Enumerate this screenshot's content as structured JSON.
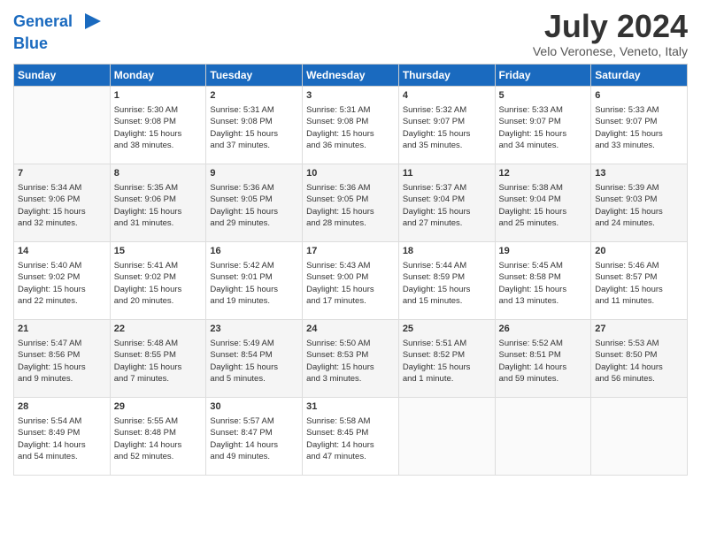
{
  "header": {
    "logo_line1": "General",
    "logo_line2": "Blue",
    "month_year": "July 2024",
    "location": "Velo Veronese, Veneto, Italy"
  },
  "weekdays": [
    "Sunday",
    "Monday",
    "Tuesday",
    "Wednesday",
    "Thursday",
    "Friday",
    "Saturday"
  ],
  "weeks": [
    [
      {
        "day": "",
        "lines": []
      },
      {
        "day": "1",
        "lines": [
          "Sunrise: 5:30 AM",
          "Sunset: 9:08 PM",
          "Daylight: 15 hours",
          "and 38 minutes."
        ]
      },
      {
        "day": "2",
        "lines": [
          "Sunrise: 5:31 AM",
          "Sunset: 9:08 PM",
          "Daylight: 15 hours",
          "and 37 minutes."
        ]
      },
      {
        "day": "3",
        "lines": [
          "Sunrise: 5:31 AM",
          "Sunset: 9:08 PM",
          "Daylight: 15 hours",
          "and 36 minutes."
        ]
      },
      {
        "day": "4",
        "lines": [
          "Sunrise: 5:32 AM",
          "Sunset: 9:07 PM",
          "Daylight: 15 hours",
          "and 35 minutes."
        ]
      },
      {
        "day": "5",
        "lines": [
          "Sunrise: 5:33 AM",
          "Sunset: 9:07 PM",
          "Daylight: 15 hours",
          "and 34 minutes."
        ]
      },
      {
        "day": "6",
        "lines": [
          "Sunrise: 5:33 AM",
          "Sunset: 9:07 PM",
          "Daylight: 15 hours",
          "and 33 minutes."
        ]
      }
    ],
    [
      {
        "day": "7",
        "lines": [
          "Sunrise: 5:34 AM",
          "Sunset: 9:06 PM",
          "Daylight: 15 hours",
          "and 32 minutes."
        ]
      },
      {
        "day": "8",
        "lines": [
          "Sunrise: 5:35 AM",
          "Sunset: 9:06 PM",
          "Daylight: 15 hours",
          "and 31 minutes."
        ]
      },
      {
        "day": "9",
        "lines": [
          "Sunrise: 5:36 AM",
          "Sunset: 9:05 PM",
          "Daylight: 15 hours",
          "and 29 minutes."
        ]
      },
      {
        "day": "10",
        "lines": [
          "Sunrise: 5:36 AM",
          "Sunset: 9:05 PM",
          "Daylight: 15 hours",
          "and 28 minutes."
        ]
      },
      {
        "day": "11",
        "lines": [
          "Sunrise: 5:37 AM",
          "Sunset: 9:04 PM",
          "Daylight: 15 hours",
          "and 27 minutes."
        ]
      },
      {
        "day": "12",
        "lines": [
          "Sunrise: 5:38 AM",
          "Sunset: 9:04 PM",
          "Daylight: 15 hours",
          "and 25 minutes."
        ]
      },
      {
        "day": "13",
        "lines": [
          "Sunrise: 5:39 AM",
          "Sunset: 9:03 PM",
          "Daylight: 15 hours",
          "and 24 minutes."
        ]
      }
    ],
    [
      {
        "day": "14",
        "lines": [
          "Sunrise: 5:40 AM",
          "Sunset: 9:02 PM",
          "Daylight: 15 hours",
          "and 22 minutes."
        ]
      },
      {
        "day": "15",
        "lines": [
          "Sunrise: 5:41 AM",
          "Sunset: 9:02 PM",
          "Daylight: 15 hours",
          "and 20 minutes."
        ]
      },
      {
        "day": "16",
        "lines": [
          "Sunrise: 5:42 AM",
          "Sunset: 9:01 PM",
          "Daylight: 15 hours",
          "and 19 minutes."
        ]
      },
      {
        "day": "17",
        "lines": [
          "Sunrise: 5:43 AM",
          "Sunset: 9:00 PM",
          "Daylight: 15 hours",
          "and 17 minutes."
        ]
      },
      {
        "day": "18",
        "lines": [
          "Sunrise: 5:44 AM",
          "Sunset: 8:59 PM",
          "Daylight: 15 hours",
          "and 15 minutes."
        ]
      },
      {
        "day": "19",
        "lines": [
          "Sunrise: 5:45 AM",
          "Sunset: 8:58 PM",
          "Daylight: 15 hours",
          "and 13 minutes."
        ]
      },
      {
        "day": "20",
        "lines": [
          "Sunrise: 5:46 AM",
          "Sunset: 8:57 PM",
          "Daylight: 15 hours",
          "and 11 minutes."
        ]
      }
    ],
    [
      {
        "day": "21",
        "lines": [
          "Sunrise: 5:47 AM",
          "Sunset: 8:56 PM",
          "Daylight: 15 hours",
          "and 9 minutes."
        ]
      },
      {
        "day": "22",
        "lines": [
          "Sunrise: 5:48 AM",
          "Sunset: 8:55 PM",
          "Daylight: 15 hours",
          "and 7 minutes."
        ]
      },
      {
        "day": "23",
        "lines": [
          "Sunrise: 5:49 AM",
          "Sunset: 8:54 PM",
          "Daylight: 15 hours",
          "and 5 minutes."
        ]
      },
      {
        "day": "24",
        "lines": [
          "Sunrise: 5:50 AM",
          "Sunset: 8:53 PM",
          "Daylight: 15 hours",
          "and 3 minutes."
        ]
      },
      {
        "day": "25",
        "lines": [
          "Sunrise: 5:51 AM",
          "Sunset: 8:52 PM",
          "Daylight: 15 hours",
          "and 1 minute."
        ]
      },
      {
        "day": "26",
        "lines": [
          "Sunrise: 5:52 AM",
          "Sunset: 8:51 PM",
          "Daylight: 14 hours",
          "and 59 minutes."
        ]
      },
      {
        "day": "27",
        "lines": [
          "Sunrise: 5:53 AM",
          "Sunset: 8:50 PM",
          "Daylight: 14 hours",
          "and 56 minutes."
        ]
      }
    ],
    [
      {
        "day": "28",
        "lines": [
          "Sunrise: 5:54 AM",
          "Sunset: 8:49 PM",
          "Daylight: 14 hours",
          "and 54 minutes."
        ]
      },
      {
        "day": "29",
        "lines": [
          "Sunrise: 5:55 AM",
          "Sunset: 8:48 PM",
          "Daylight: 14 hours",
          "and 52 minutes."
        ]
      },
      {
        "day": "30",
        "lines": [
          "Sunrise: 5:57 AM",
          "Sunset: 8:47 PM",
          "Daylight: 14 hours",
          "and 49 minutes."
        ]
      },
      {
        "day": "31",
        "lines": [
          "Sunrise: 5:58 AM",
          "Sunset: 8:45 PM",
          "Daylight: 14 hours",
          "and 47 minutes."
        ]
      },
      {
        "day": "",
        "lines": []
      },
      {
        "day": "",
        "lines": []
      },
      {
        "day": "",
        "lines": []
      }
    ]
  ]
}
